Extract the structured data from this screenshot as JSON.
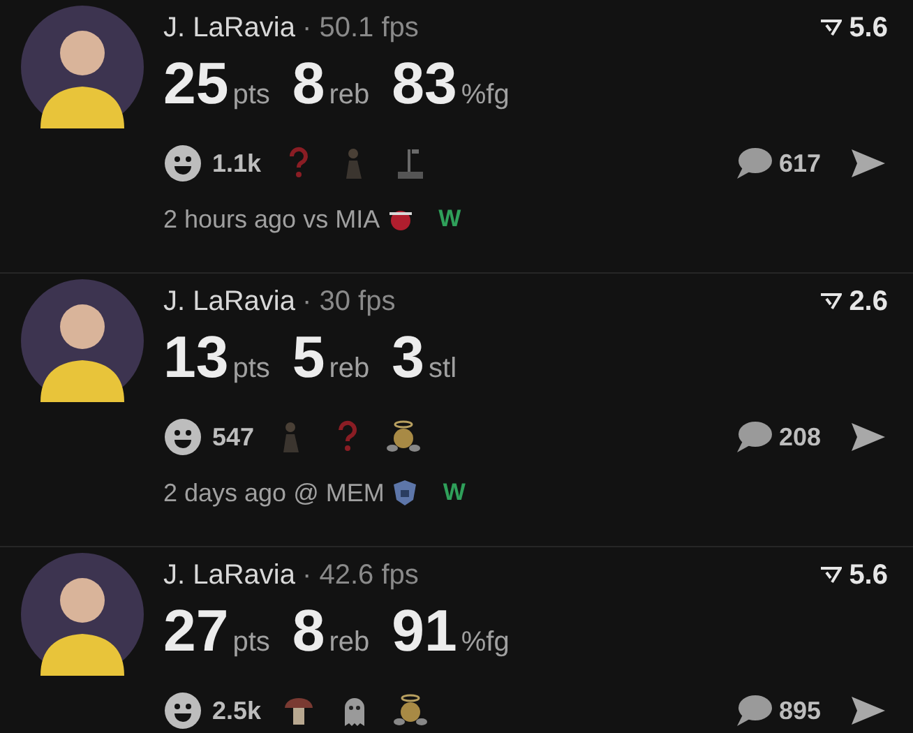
{
  "posts": [
    {
      "player": "J. LaRavia",
      "fps": "· 50.1 fps",
      "score": "5.6",
      "stats": [
        {
          "value": "25",
          "unit": "pts"
        },
        {
          "value": "8",
          "unit": "reb"
        },
        {
          "value": "83",
          "unit": "%fg"
        }
      ],
      "reactions_count": "1.1k",
      "reactions": [
        {
          "kind": "question"
        },
        {
          "kind": "figure"
        },
        {
          "kind": "stand"
        }
      ],
      "comments": "617",
      "time": "2 hours ago vs MIA",
      "team": {
        "kind": "heat"
      },
      "result": "W"
    },
    {
      "player": "J. LaRavia",
      "fps": "· 30 fps",
      "score": "2.6",
      "stats": [
        {
          "value": "13",
          "unit": "pts"
        },
        {
          "value": "5",
          "unit": "reb"
        },
        {
          "value": "3",
          "unit": "stl"
        }
      ],
      "reactions_count": "547",
      "reactions": [
        {
          "kind": "figure"
        },
        {
          "kind": "question"
        },
        {
          "kind": "angel"
        }
      ],
      "comments": "208",
      "time": "2 days ago @ MEM",
      "team": {
        "kind": "grizzlies"
      },
      "result": "W"
    },
    {
      "player": "J. LaRavia",
      "fps": "· 42.6 fps",
      "score": "5.6",
      "stats": [
        {
          "value": "27",
          "unit": "pts"
        },
        {
          "value": "8",
          "unit": "reb"
        },
        {
          "value": "91",
          "unit": "%fg"
        }
      ],
      "reactions_count": "2.5k",
      "reactions": [
        {
          "kind": "mushroom"
        },
        {
          "kind": "ghost"
        },
        {
          "kind": "angel"
        }
      ],
      "comments": "895"
    }
  ]
}
